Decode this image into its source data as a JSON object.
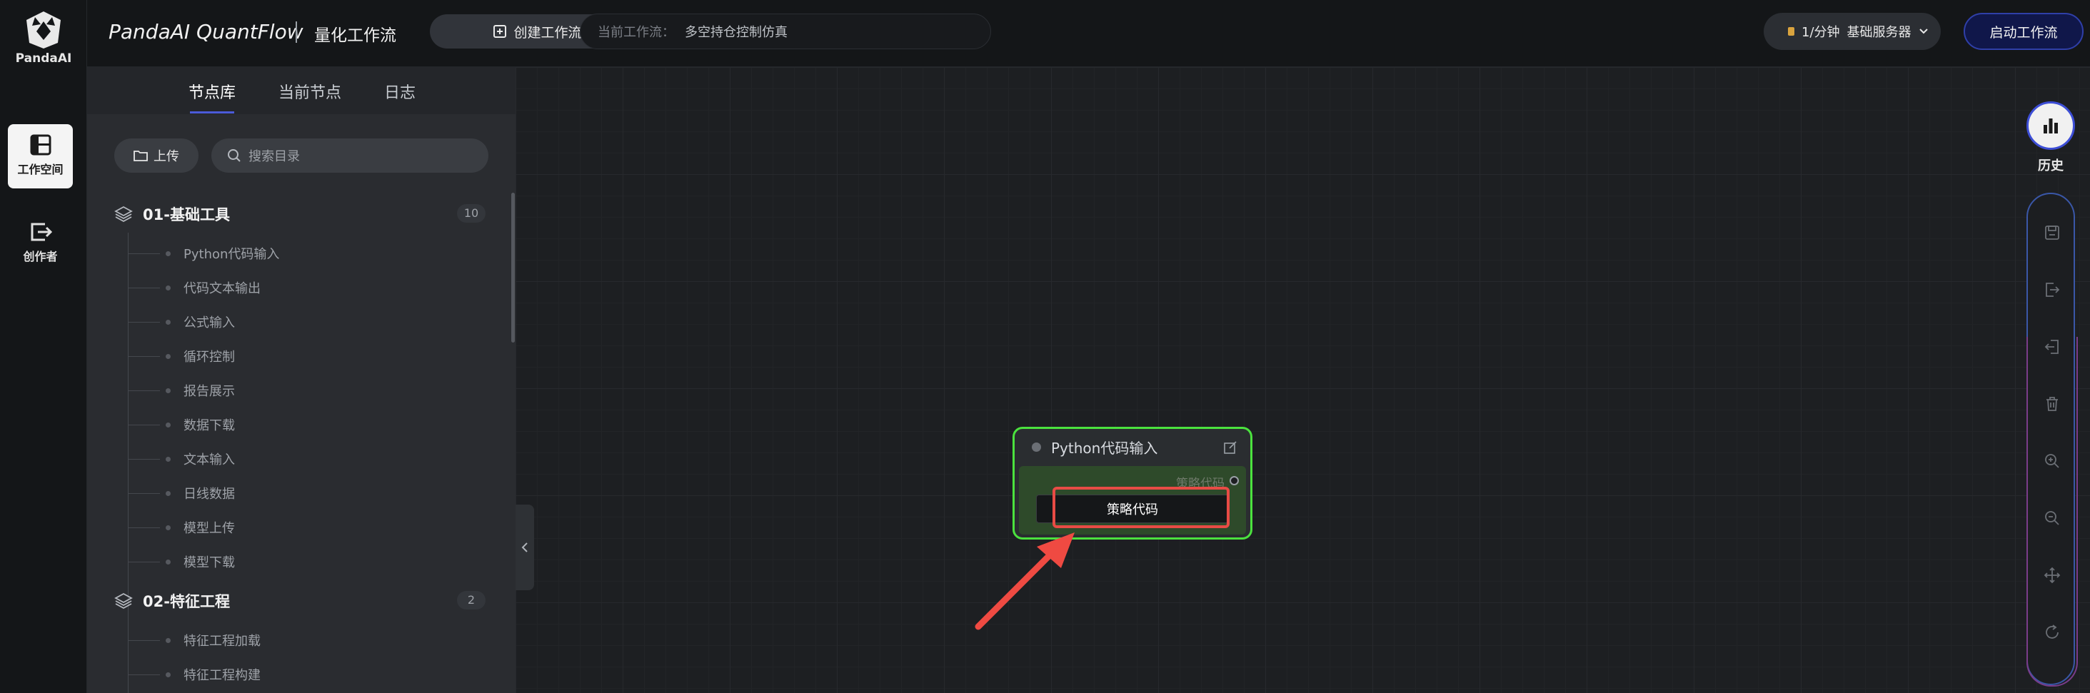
{
  "brand": {
    "logo_text": "PandaAI",
    "name": "PandaAI QuantFlow",
    "subtitle": "量化工作流"
  },
  "rail": {
    "items": [
      {
        "label": "工作空间",
        "icon": "layout-icon",
        "active": true
      },
      {
        "label": "创作者",
        "icon": "exit-icon",
        "active": false
      }
    ]
  },
  "topbar": {
    "create_label": "创建工作流",
    "current_flow_key": "当前工作流：",
    "current_flow_value": "多空持仓控制仿真",
    "server_rate": "1/分钟",
    "server_name": "基础服务器",
    "start_label": "启动工作流"
  },
  "sidebar": {
    "tabs": [
      {
        "label": "节点库",
        "active": true
      },
      {
        "label": "当前节点",
        "active": false
      },
      {
        "label": "日志",
        "active": false
      }
    ],
    "upload_label": "上传",
    "search_placeholder": "搜索目录",
    "groups": [
      {
        "name": "01-基础工具",
        "count": "10",
        "items": [
          "Python代码输入",
          "代码文本输出",
          "公式输入",
          "循环控制",
          "报告展示",
          "数据下载",
          "文本输入",
          "日线数据",
          "模型上传",
          "模型下载"
        ]
      },
      {
        "name": "02-特征工程",
        "count": "2",
        "items": [
          "特征工程加载",
          "特征工程构建"
        ]
      }
    ]
  },
  "node": {
    "title": "Python代码输入",
    "port_label": "策略代码",
    "button_label": "策略代码"
  },
  "right_toolbar": {
    "history_label": "历史",
    "tools": [
      "save-icon",
      "export-icon",
      "import-icon",
      "delete-icon",
      "zoom-in-icon",
      "zoom-out-icon",
      "move-icon",
      "refresh-icon"
    ]
  },
  "colors": {
    "accent": "#3d4ed6",
    "node_border": "#4be23e",
    "highlight": "#e84b45"
  }
}
